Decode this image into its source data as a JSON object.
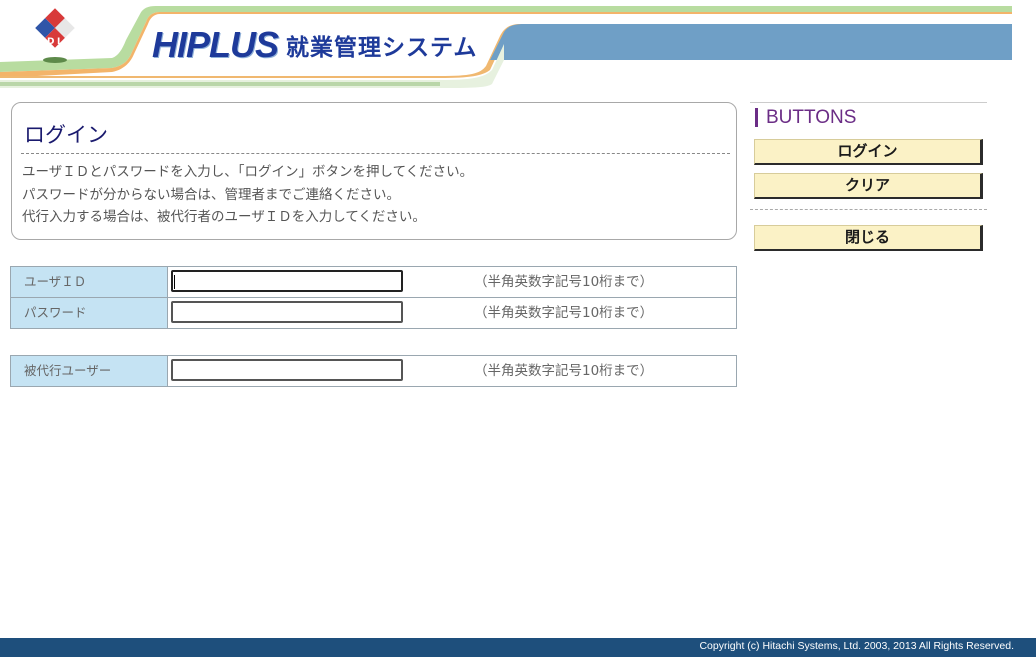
{
  "header": {
    "brand_main": "HIPLUS",
    "brand_sub": "就業管理システム"
  },
  "login_panel": {
    "title": "ログイン",
    "instructions": [
      "ユーザＩＤとパスワードを入力し、「ログイン」ボタンを押してください。",
      "パスワードが分からない場合は、管理者までご連絡ください。",
      "代行入力する場合は、被代行者のユーザＩＤを入力してください。"
    ]
  },
  "form": {
    "user_id": {
      "label": "ユーザＩＤ",
      "value": "",
      "hint": "（半角英数字記号10桁まで）"
    },
    "password": {
      "label": "パスワード",
      "value": "",
      "hint": "（半角英数字記号10桁まで）"
    },
    "proxy_user": {
      "label": "被代行ユーザー",
      "value": "",
      "hint": "（半角英数字記号10桁まで）"
    }
  },
  "buttons": {
    "header": "BUTTONS",
    "login": "ログイン",
    "clear": "クリア",
    "close": "閉じる"
  },
  "footer": {
    "copyright": "Copyright (c) Hitachi Systems, Ltd. 2003, 2013 All Rights Reserved."
  },
  "colors": {
    "footer_bg": "#1e4f7c",
    "label_bg": "#c5e3f3",
    "button_bg": "#fbf2c6",
    "brand": "#1e3a9a",
    "buttons_header": "#6b2d86"
  }
}
